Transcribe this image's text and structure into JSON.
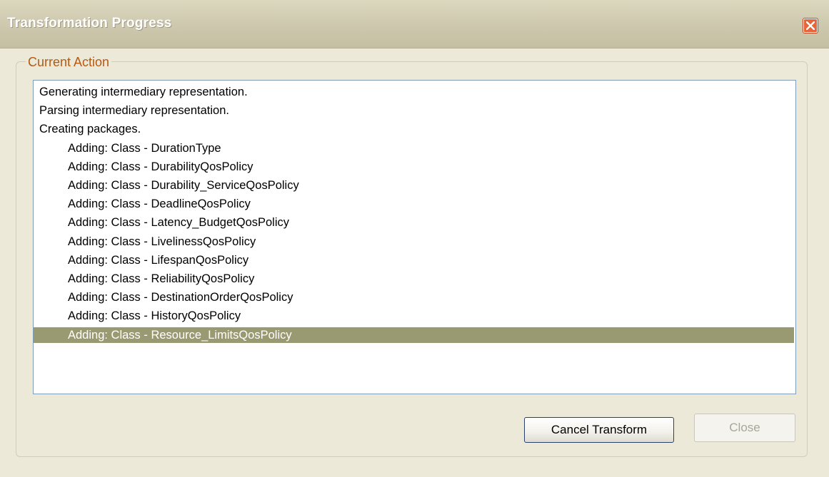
{
  "window": {
    "title": "Transformation Progress",
    "close_icon": "close-icon"
  },
  "group": {
    "legend": "Current Action"
  },
  "log": {
    "items": [
      {
        "text": "Generating intermediary representation.",
        "indent": false,
        "selected": false
      },
      {
        "text": "Parsing intermediary representation.",
        "indent": false,
        "selected": false
      },
      {
        "text": "Creating packages.",
        "indent": false,
        "selected": false
      },
      {
        "text": "Adding: Class - DurationType",
        "indent": true,
        "selected": false
      },
      {
        "text": "Adding: Class - DurabilityQosPolicy",
        "indent": true,
        "selected": false
      },
      {
        "text": "Adding: Class - Durability_ServiceQosPolicy",
        "indent": true,
        "selected": false
      },
      {
        "text": "Adding: Class - DeadlineQosPolicy",
        "indent": true,
        "selected": false
      },
      {
        "text": "Adding: Class - Latency_BudgetQosPolicy",
        "indent": true,
        "selected": false
      },
      {
        "text": "Adding: Class - LivelinessQosPolicy",
        "indent": true,
        "selected": false
      },
      {
        "text": "Adding: Class - LifespanQosPolicy",
        "indent": true,
        "selected": false
      },
      {
        "text": "Adding: Class - ReliabilityQosPolicy",
        "indent": true,
        "selected": false
      },
      {
        "text": "Adding: Class - DestinationOrderQosPolicy",
        "indent": true,
        "selected": false
      },
      {
        "text": "Adding: Class - HistoryQosPolicy",
        "indent": true,
        "selected": false
      },
      {
        "text": "Adding: Class - Resource_LimitsQosPolicy",
        "indent": true,
        "selected": true
      }
    ]
  },
  "buttons": {
    "cancel_label": "Cancel Transform",
    "close_label": "Close",
    "close_enabled": false
  },
  "colors": {
    "selection": "#9a9a72",
    "legend": "#b55a14",
    "close_button": "#e8643a"
  }
}
